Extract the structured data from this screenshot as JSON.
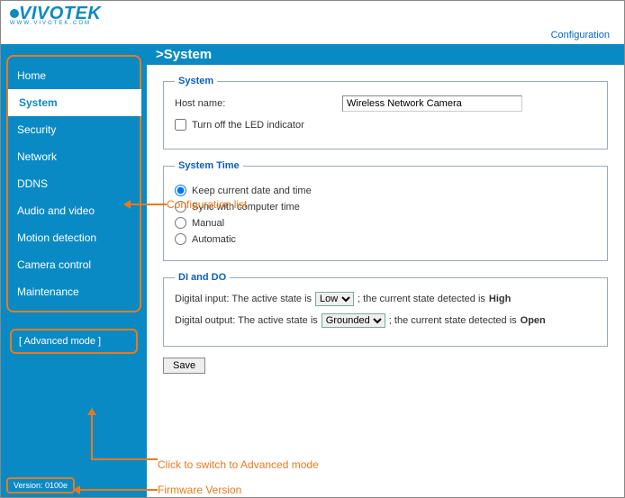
{
  "brand": {
    "name": "VIVOTEK",
    "sub": "WWW.VIVOTEK.COM"
  },
  "header": {
    "config_link": "Configuration"
  },
  "sidebar": {
    "items": [
      {
        "label": "Home"
      },
      {
        "label": "System"
      },
      {
        "label": "Security"
      },
      {
        "label": "Network"
      },
      {
        "label": "DDNS"
      },
      {
        "label": "Audio and video"
      },
      {
        "label": "Motion detection"
      },
      {
        "label": "Camera control"
      },
      {
        "label": "Maintenance"
      }
    ],
    "advanced": "[ Advanced mode ]",
    "version": "Version: 0100e"
  },
  "page": {
    "title": ">System",
    "system": {
      "legend": "System",
      "hostname_label": "Host name:",
      "hostname_value": "Wireless Network Camera",
      "led_label": "Turn off the LED indicator"
    },
    "time": {
      "legend": "System Time",
      "opt_keep": "Keep current date and time",
      "opt_sync": "Sync with computer time",
      "opt_manual": "Manual",
      "opt_auto": "Automatic"
    },
    "dido": {
      "legend": "DI and DO",
      "di_pre": "Digital input: The active state is",
      "di_select": "Low",
      "di_post": "; the current state detected is",
      "di_state": "High",
      "do_pre": "Digital output: The active state is",
      "do_select": "Grounded",
      "do_post": "; the current state detected is",
      "do_state": "Open"
    },
    "save": "Save"
  },
  "annotations": {
    "config_list": "Configuration list",
    "advanced": "Click to switch to Advanced mode",
    "firmware": "Firmware Version"
  }
}
